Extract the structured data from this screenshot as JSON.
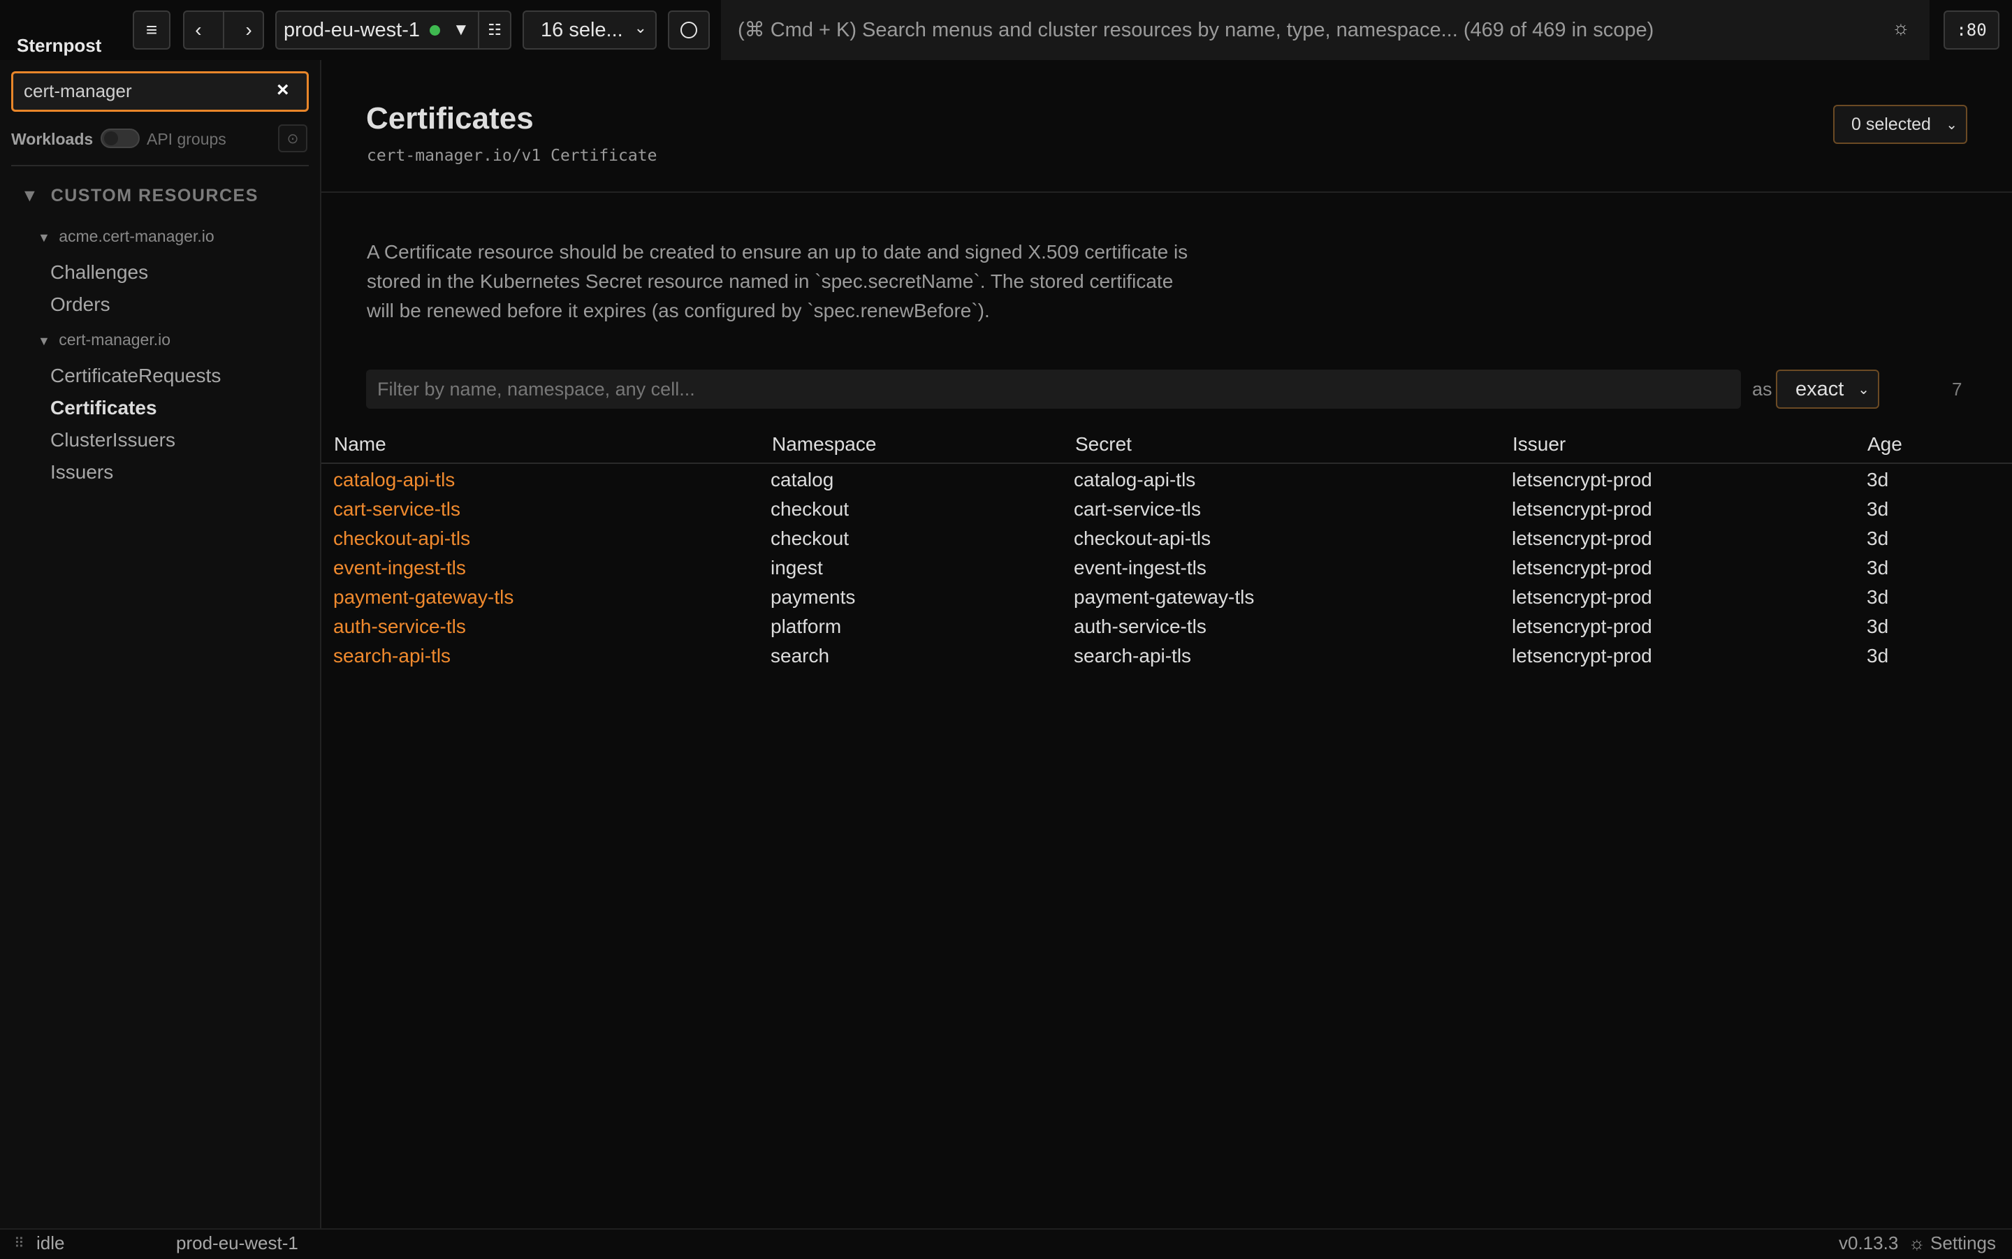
{
  "app": {
    "name": "Sternpost"
  },
  "toolbar": {
    "menu_icon": "≡",
    "back_icon": "‹",
    "forward_icon": "›",
    "cluster": "prod-eu-west-1",
    "cluster_status_color": "#3fb950",
    "cluster_caret": "▼",
    "cluster_grid_icon": "☷",
    "namespace_selector": "16 sele...",
    "search_placeholder": "(⌘ Cmd + K) Search menus and cluster resources by name, type, namespace... (469 of 469 in scope)",
    "theme_icon": "☼",
    "port": ":80"
  },
  "sidebar": {
    "search_value": "cert-manager",
    "clear_icon": "×",
    "workloads_label": "Workloads",
    "api_groups_label": "API groups",
    "api_groups_enabled": false,
    "reset_icon": "⊙",
    "section": {
      "caret": "▼",
      "title": "CUSTOM RESOURCES"
    },
    "groups": [
      {
        "caret": "▼",
        "name": "acme.cert-manager.io",
        "items": [
          "Challenges",
          "Orders"
        ]
      },
      {
        "caret": "▼",
        "name": "cert-manager.io",
        "items": [
          "CertificateRequests",
          "Certificates",
          "ClusterIssuers",
          "Issuers"
        ]
      }
    ],
    "active_item": "Certificates"
  },
  "main": {
    "title": "Certificates",
    "api_version": "cert-manager.io/v1 Certificate",
    "selected_dropdown": "0 selected",
    "description": "A Certificate resource should be created to ensure an up to date and signed X.509 certificate is stored in the Kubernetes Secret resource named in `spec.secretName`. The stored certificate will be renewed before it expires (as configured by `spec.renewBefore`).",
    "filter_placeholder": "Filter by name, namespace, any cell...",
    "as_label": "as",
    "match_mode": "exact",
    "row_count": "7",
    "columns": [
      "Name",
      "Namespace",
      "Secret",
      "Issuer",
      "Age"
    ],
    "rows": [
      {
        "name": "catalog-api-tls",
        "namespace": "catalog",
        "secret": "catalog-api-tls",
        "issuer": "letsencrypt-prod",
        "age": "3d"
      },
      {
        "name": "cart-service-tls",
        "namespace": "checkout",
        "secret": "cart-service-tls",
        "issuer": "letsencrypt-prod",
        "age": "3d"
      },
      {
        "name": "checkout-api-tls",
        "namespace": "checkout",
        "secret": "checkout-api-tls",
        "issuer": "letsencrypt-prod",
        "age": "3d"
      },
      {
        "name": "event-ingest-tls",
        "namespace": "ingest",
        "secret": "event-ingest-tls",
        "issuer": "letsencrypt-prod",
        "age": "3d"
      },
      {
        "name": "payment-gateway-tls",
        "namespace": "payments",
        "secret": "payment-gateway-tls",
        "issuer": "letsencrypt-prod",
        "age": "3d"
      },
      {
        "name": "auth-service-tls",
        "namespace": "platform",
        "secret": "auth-service-tls",
        "issuer": "letsencrypt-prod",
        "age": "3d"
      },
      {
        "name": "search-api-tls",
        "namespace": "search",
        "secret": "search-api-tls",
        "issuer": "letsencrypt-prod",
        "age": "3d"
      }
    ]
  },
  "statusbar": {
    "grip_icon": "⠿",
    "state": "idle",
    "cluster": "prod-eu-west-1",
    "version": "v0.13.3",
    "settings_label": "☼ Settings"
  },
  "colors": {
    "accent": "#f08a2e",
    "background": "#0b0b0b",
    "sidebar": "#0f0f0f"
  }
}
